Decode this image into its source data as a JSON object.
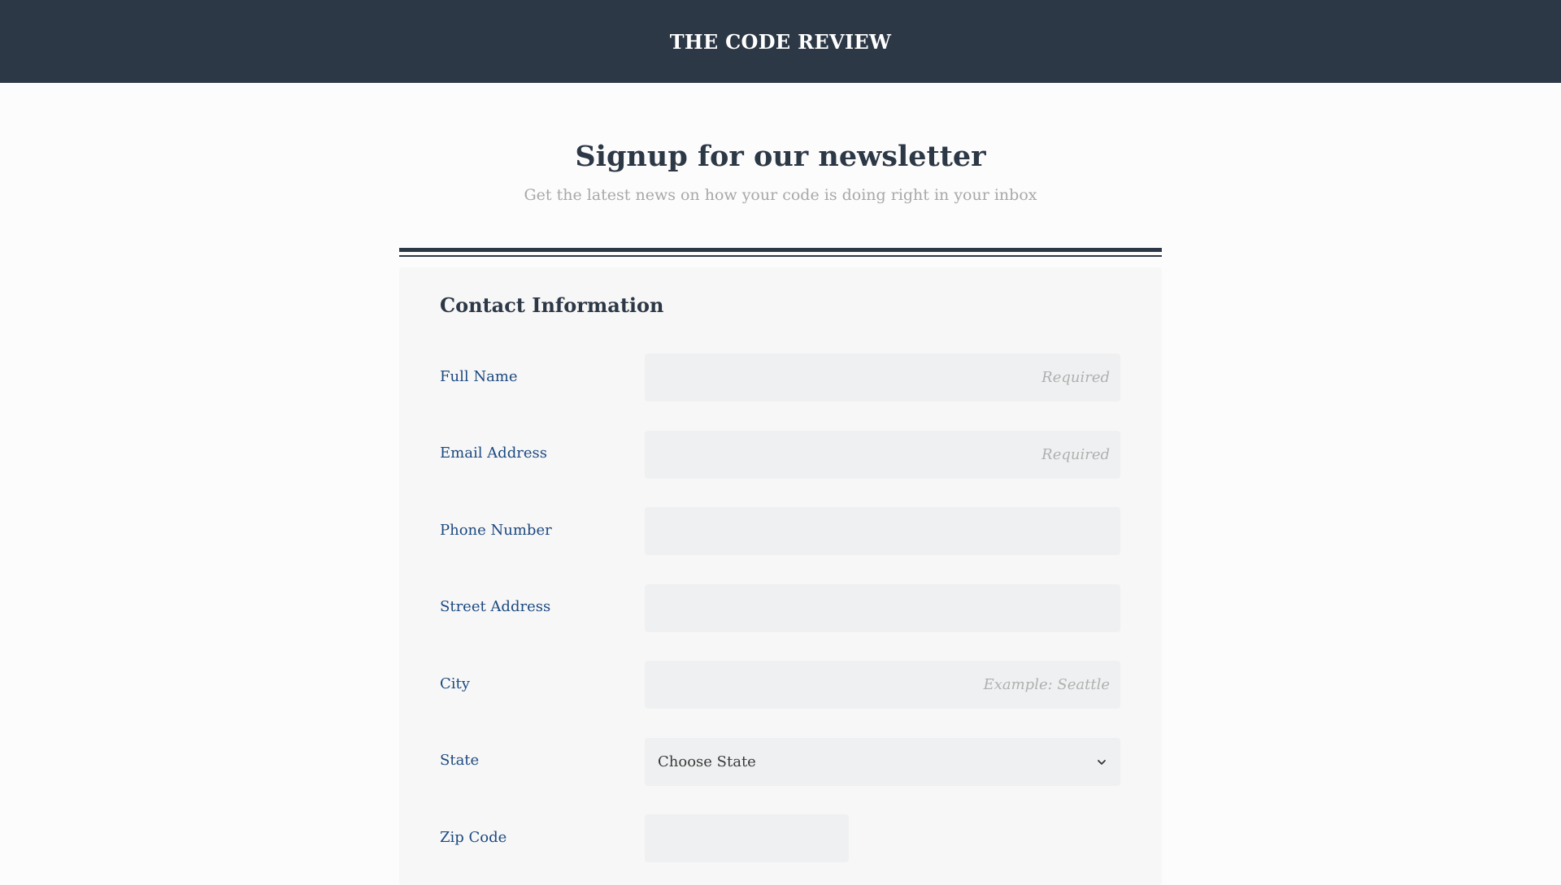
{
  "header": {
    "brand": "THE CODE REVIEW"
  },
  "hero": {
    "title": "Signup for our newsletter",
    "subtitle": "Get the latest news on how your code is doing right in your inbox"
  },
  "form": {
    "section_title": "Contact Information",
    "fields": {
      "full_name": {
        "label": "Full Name",
        "placeholder": "Required",
        "value": ""
      },
      "email": {
        "label": "Email Address",
        "placeholder": "Required",
        "value": ""
      },
      "phone": {
        "label": "Phone Number",
        "placeholder": "",
        "value": ""
      },
      "street": {
        "label": "Street Address",
        "placeholder": "",
        "value": ""
      },
      "city": {
        "label": "City",
        "placeholder": "Example: Seattle",
        "value": ""
      },
      "state": {
        "label": "State",
        "selected": "Choose State"
      },
      "zip": {
        "label": "Zip Code",
        "placeholder": "",
        "value": ""
      }
    }
  },
  "colors": {
    "header_bg": "#2d3846",
    "label": "#1c4980",
    "input_bg": "#eff0f1",
    "card_bg": "#f7f7f7"
  },
  "icons": {
    "state_dropdown": "chevron-down-icon"
  }
}
